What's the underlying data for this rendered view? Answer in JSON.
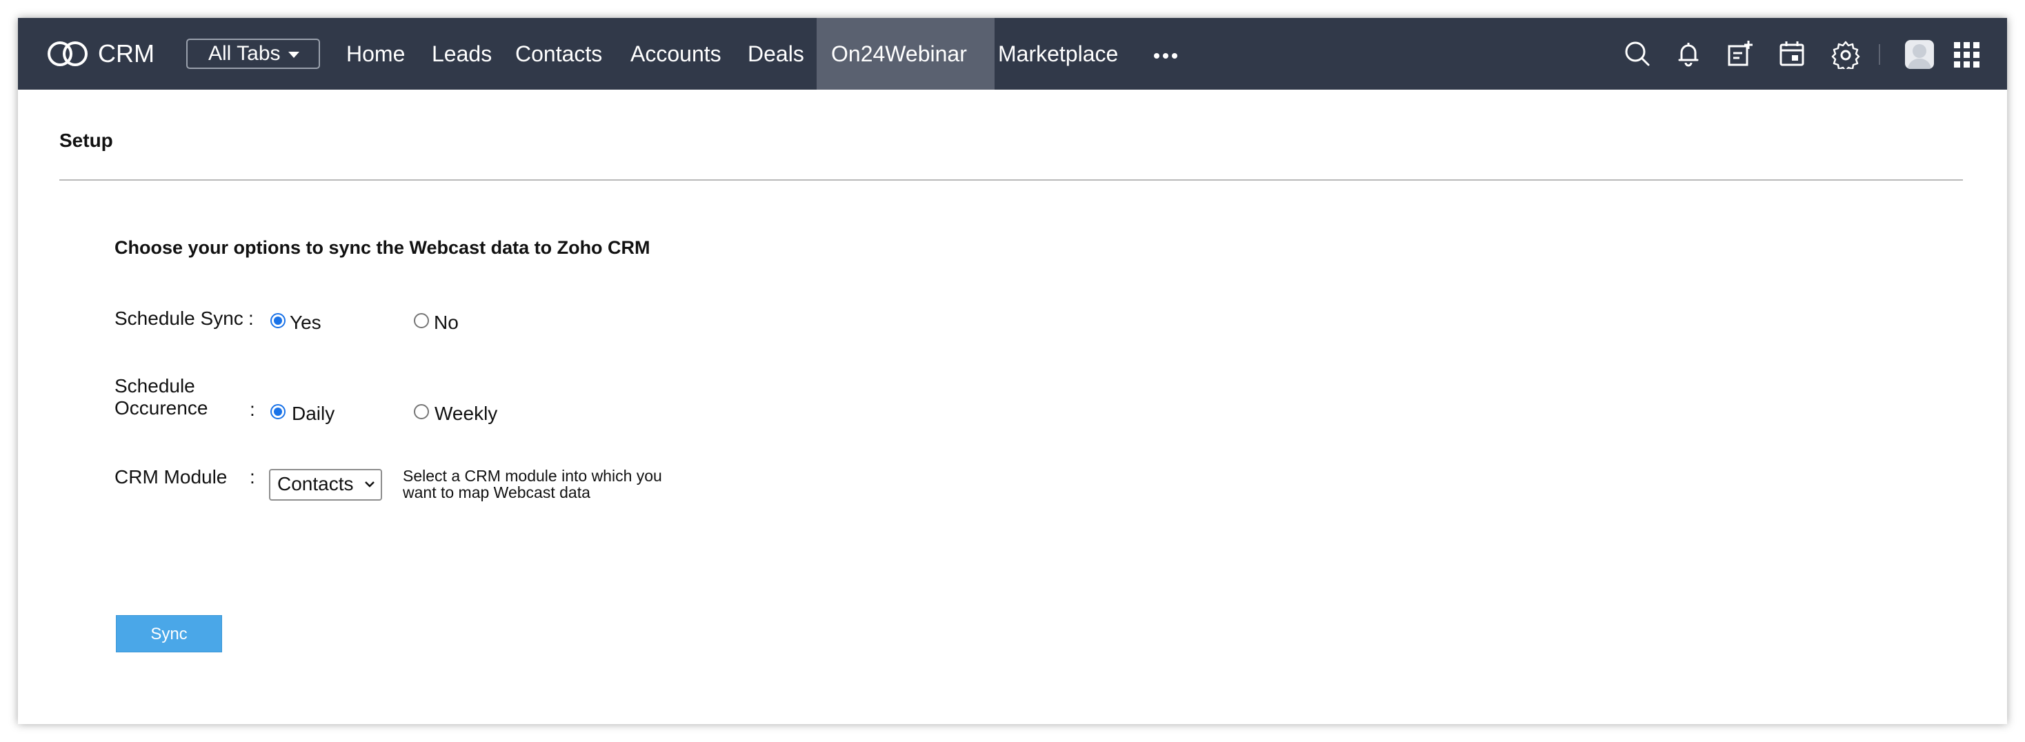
{
  "topbar": {
    "brand": "CRM",
    "all_tabs_label": "All Tabs",
    "tabs": [
      {
        "label": "Home"
      },
      {
        "label": "Leads"
      },
      {
        "label": "Contacts"
      },
      {
        "label": "Accounts"
      },
      {
        "label": "Deals"
      },
      {
        "label": "On24Webinar",
        "active": true
      },
      {
        "label": "Marketplace"
      }
    ],
    "icons": [
      "search-icon",
      "bell-icon",
      "add-note-icon",
      "calendar-icon",
      "gear-icon",
      "avatar",
      "apps-grid-icon"
    ],
    "colors": {
      "bar": "#313949",
      "active_tab": "#5a6170"
    }
  },
  "page": {
    "title": "Setup",
    "intro": "Choose your options to sync the Webcast data to Zoho CRM"
  },
  "form": {
    "schedule_sync": {
      "label": "Schedule Sync",
      "colon": ":",
      "options": [
        "Yes",
        "No"
      ],
      "selected": "Yes"
    },
    "schedule_occurrence": {
      "label_line1": "Schedule",
      "label_line2": "Occurence",
      "colon": ":",
      "options": [
        "Daily",
        "Weekly"
      ],
      "selected": "Daily"
    },
    "crm_module": {
      "label": "CRM Module",
      "colon": ":",
      "selected": "Contacts",
      "hint": "Select a CRM module into which you want to map Webcast data"
    },
    "sync_button": "Sync"
  },
  "colors": {
    "accent": "#1a73e8",
    "sync_button": "#4aa7e8"
  }
}
